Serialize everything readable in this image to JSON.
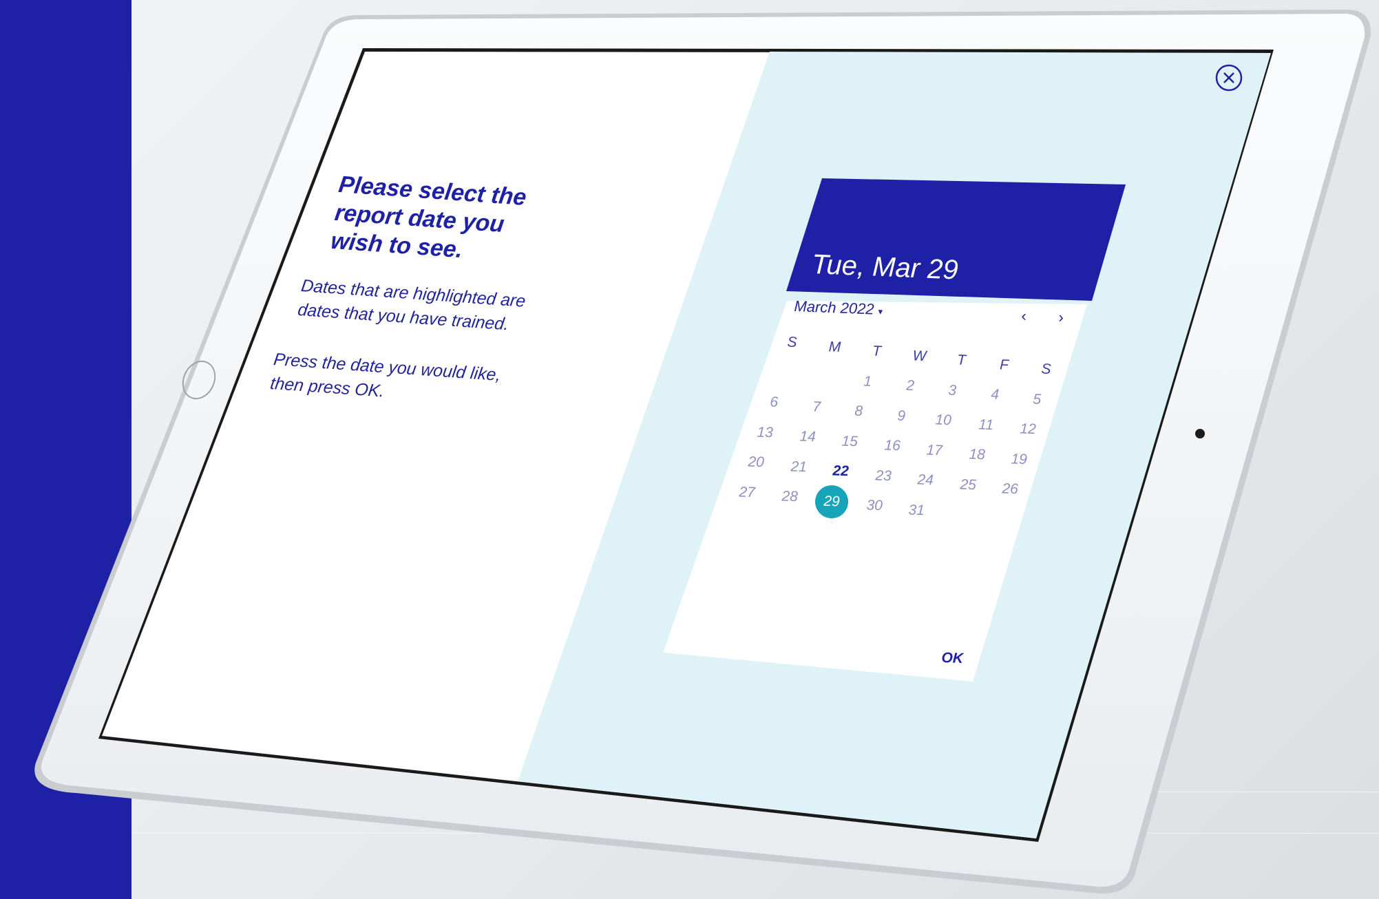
{
  "intro": {
    "heading": "Please select the report date you wish to see.",
    "paragraph_1": "Dates that are highlighted are dates that you have trained.",
    "paragraph_2": "Press the date you would like, then press OK."
  },
  "date_picker": {
    "selected_display": "Tue, Mar 29",
    "month_label": "March 2022",
    "prev_arrow": "‹",
    "next_arrow": "›",
    "weekdays": [
      "S",
      "M",
      "T",
      "W",
      "T",
      "F",
      "S"
    ],
    "first_weekday_index": 2,
    "days": [
      "1",
      "2",
      "3",
      "4",
      "5",
      "6",
      "7",
      "8",
      "9",
      "10",
      "11",
      "12",
      "13",
      "14",
      "15",
      "16",
      "17",
      "18",
      "19",
      "20",
      "21",
      "22",
      "23",
      "24",
      "25",
      "26",
      "27",
      "28",
      "29",
      "30",
      "31"
    ],
    "trained_days": [
      "22"
    ],
    "selected_day": "29",
    "ok_label": "OK"
  },
  "icons": {
    "close": "close-icon",
    "month_dropdown": "chevron-down-icon",
    "prev": "chevron-left-icon",
    "next": "chevron-right-icon"
  },
  "colors": {
    "brand_blue": "#1e20a5",
    "panel_tint": "#dff2f7",
    "selected_teal": "#16a5b8",
    "muted_day": "#8e90c4"
  }
}
